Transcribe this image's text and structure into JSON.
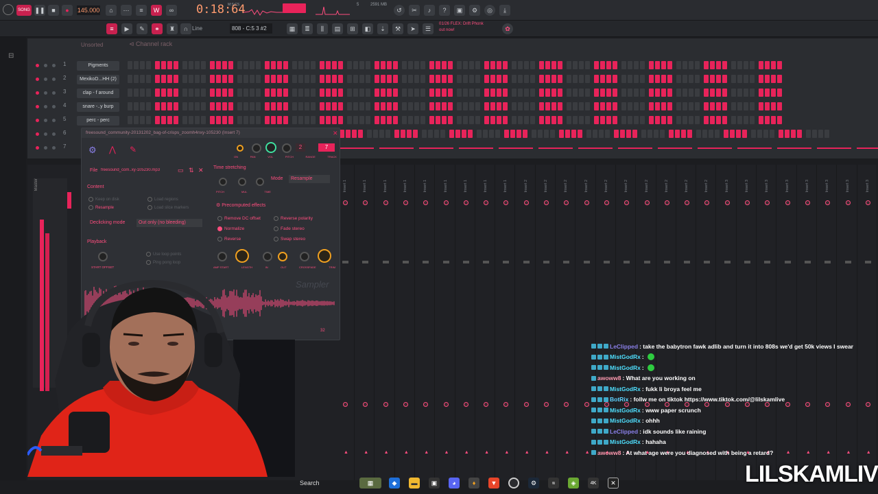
{
  "toolbar": {
    "song_label": "SONG",
    "tempo": "145.000",
    "time": "0:18:64",
    "time_sub": "M:S:CS",
    "cpu_mem": "2591 MB",
    "voices": "5",
    "mode_label": "Line",
    "note_label": "808 - C:5 3 #2",
    "hint_line1": "01/26 FLEX: Drift Phonk",
    "hint_line2": "out now!"
  },
  "channel_rack": {
    "filter_label": "Unsorted",
    "title": "Channel rack",
    "channels": [
      {
        "num": "1",
        "name": "Pigments"
      },
      {
        "num": "2",
        "name": "MexikoD...HH (2)"
      },
      {
        "num": "3",
        "name": "clap - f around"
      },
      {
        "num": "4",
        "name": "snare -..y burp"
      },
      {
        "num": "5",
        "name": "perc - perc"
      },
      {
        "num": "6",
        "name": ""
      },
      {
        "num": "7",
        "name": ""
      }
    ]
  },
  "sampler": {
    "title": "freesound_community-20131202_bag-of-crisps_zoomh4nxy-105230 (Insert 7)",
    "file_label": "File",
    "file_name": "freesound_com..xy-105230.mp3",
    "track_value": "7",
    "pitch_range": "2",
    "knob_labels": [
      "ON",
      "PAN",
      "VOL",
      "PITCH",
      "RANGE",
      "TRACK"
    ],
    "time_stretching": "Time stretching",
    "ts_knobs": [
      "PITCH",
      "MUL",
      "TIME"
    ],
    "mode_label": "Mode",
    "mode_value": "Resample",
    "content_label": "Content",
    "content_opts": [
      "Keep on disk",
      "Resample",
      "Load regions",
      "Load slice markers"
    ],
    "declicking_label": "Declicking mode",
    "declicking_value": "Out only (no bleeding)",
    "precomputed": "Precomputed effects",
    "effects": [
      "Remove DC offset",
      "Reverse polarity",
      "Normalize",
      "Fade stereo",
      "Reverse",
      "Swap stereo"
    ],
    "playback_label": "Playback",
    "loop_opts": [
      "Use loop points",
      "Ping pong loop"
    ],
    "start_offset": "START OFFSET",
    "env_knobs": [
      "AMP START",
      "LENGTH",
      "IN",
      "OUT",
      "CROSSFADE",
      "TRIM"
    ],
    "watermark": "Sampler",
    "counter": "32"
  },
  "mixer": {
    "master": "Master",
    "inserts": [
      "Insert 1",
      "Insert 1",
      "Insert 1",
      "Insert 1",
      "Insert 1",
      "Insert 1",
      "Insert 1",
      "Insert 1",
      "Insert 1",
      "Insert 2",
      "Insert 2",
      "Insert 2",
      "Insert 2",
      "Insert 2",
      "Insert 2",
      "Insert 2",
      "Insert 2",
      "Insert 2",
      "Insert 2",
      "Insert 3",
      "Insert 3",
      "Insert 3",
      "Insert 3",
      "Insert 3",
      "Insert 3",
      "Insert 3",
      "Insert 3"
    ]
  },
  "chat": [
    {
      "user": "LeClipped",
      "text": ": take the babytron fawk adlib and turn it into 808s we'd get 50k views I swear",
      "cls": "user-c",
      "badges": 3
    },
    {
      "user": "MistGodRx",
      "text": ":",
      "cls": "user-b",
      "badges": 3,
      "emote": true
    },
    {
      "user": "MistGodRx",
      "text": ":",
      "cls": "user-b",
      "badges": 3,
      "emote": true
    },
    {
      "user": "awoww8",
      "text": ": What are you working on",
      "cls": "user-d",
      "badges": 1
    },
    {
      "user": "MistGodRx",
      "text": ": fukk li broya feel me",
      "cls": "user-b",
      "badges": 3
    },
    {
      "user": "BotRix",
      "text": ": follw me on tiktok https://www.tiktok.com/@lilskamlive",
      "cls": "user-a",
      "badges": 3
    },
    {
      "user": "MistGodRx",
      "text": ": www paper scrunch",
      "cls": "user-b",
      "badges": 3
    },
    {
      "user": "MistGodRx",
      "text": ": ohhh",
      "cls": "user-b",
      "badges": 3
    },
    {
      "user": "LeClipped",
      "text": ": idk sounds like raining",
      "cls": "user-c",
      "badges": 3
    },
    {
      "user": "MistGodRx",
      "text": ": hahaha",
      "cls": "user-b",
      "badges": 3
    },
    {
      "user": "awoww8",
      "text": ": At what age were you diagnosed with being a retard?",
      "cls": "user-d",
      "badges": 1
    }
  ],
  "taskbar": {
    "search_label": "Search"
  },
  "overlay": {
    "streamer_name": "LILSKAMLIVE"
  },
  "colors": {
    "accent": "#e8235a",
    "knob_gold": "#f0a020",
    "panel": "#2e3035",
    "background": "#1c1d20"
  }
}
